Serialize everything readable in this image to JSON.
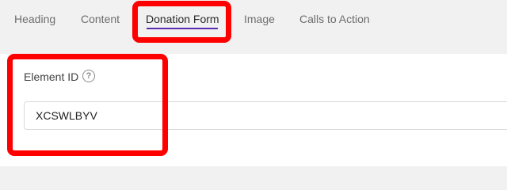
{
  "tabs": [
    {
      "label": "Heading",
      "active": false
    },
    {
      "label": "Content",
      "active": false
    },
    {
      "label": "Donation Form",
      "active": true
    },
    {
      "label": "Image",
      "active": false
    },
    {
      "label": "Calls to Action",
      "active": false
    }
  ],
  "field": {
    "label": "Element ID",
    "help_icon_glyph": "?",
    "value": "XCSWLBYV"
  },
  "colors": {
    "active_tab_underline": "#5b2bb3",
    "annotation": "#ff0000"
  }
}
